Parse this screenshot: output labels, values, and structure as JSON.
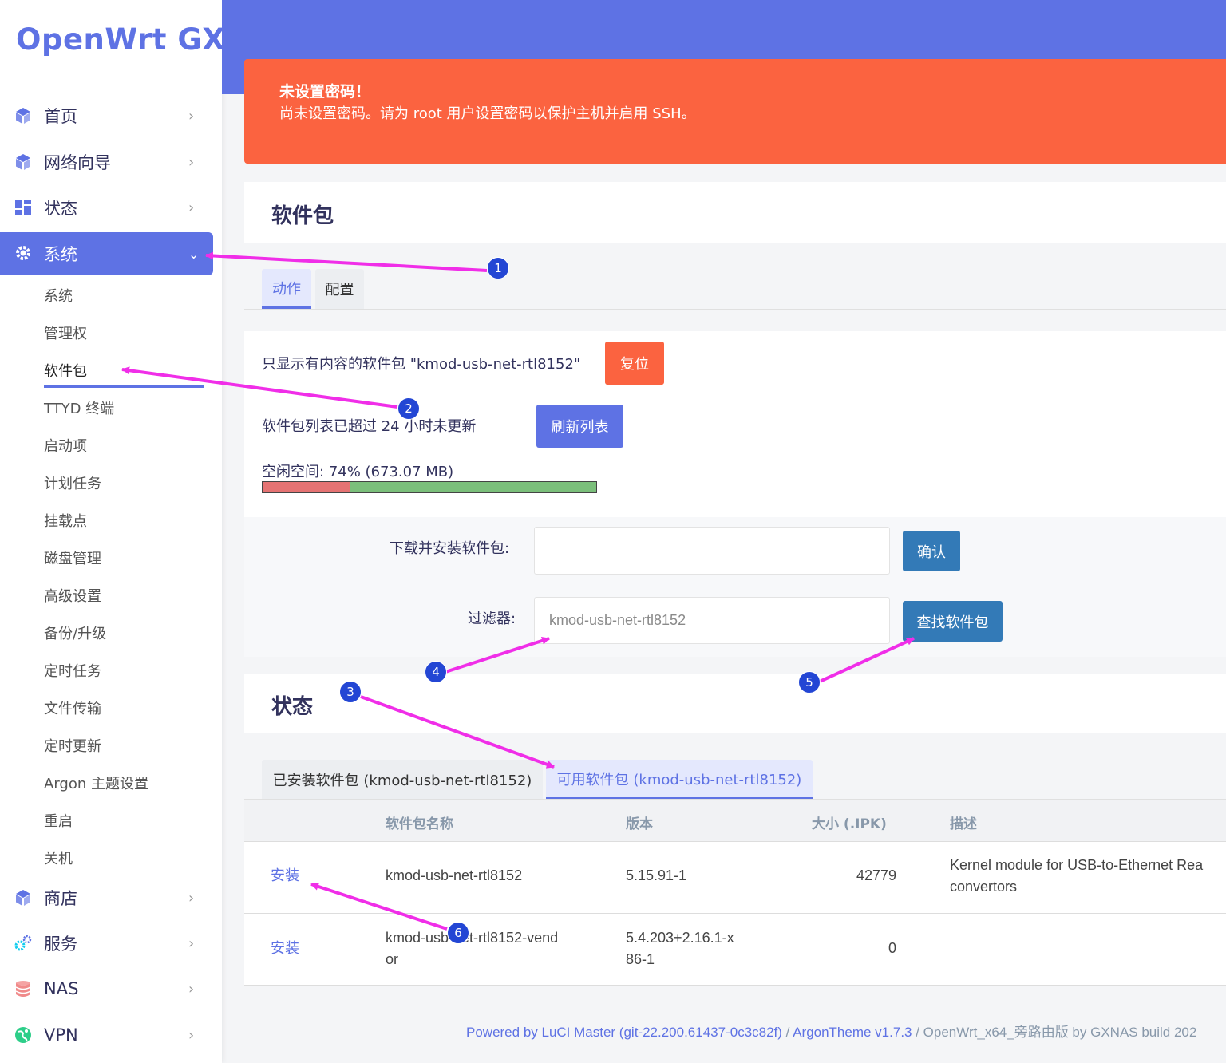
{
  "brand": "OpenWrt GXN",
  "sidebar": {
    "items": [
      {
        "label": "首页",
        "icon": "cube-icon"
      },
      {
        "label": "网络向导",
        "icon": "cube-icon"
      },
      {
        "label": "状态",
        "icon": "dashboard-icon"
      },
      {
        "label": "系统",
        "icon": "gear-icon"
      },
      {
        "label": "商店",
        "icon": "cube-icon"
      },
      {
        "label": "服务",
        "icon": "gears-icon"
      },
      {
        "label": "NAS",
        "icon": "database-icon"
      },
      {
        "label": "VPN",
        "icon": "globe-icon"
      }
    ],
    "sub_items": [
      "系统",
      "管理权",
      "软件包",
      "TTYD 终端",
      "启动项",
      "计划任务",
      "挂载点",
      "磁盘管理",
      "高级设置",
      "备份/升级",
      "定时任务",
      "文件传输",
      "定时更新",
      "Argon 主题设置",
      "重启",
      "关机"
    ]
  },
  "alert": {
    "title": "未设置密码！",
    "body": "尚未设置密码。请为 root 用户设置密码以保护主机并启用 SSH。"
  },
  "page_title": "软件包",
  "tabs": [
    "动作",
    "配置"
  ],
  "filter_notice": "只显示有内容的软件包 \"kmod-usb-net-rtl8152\"",
  "reset_label": "复位",
  "update_notice": "软件包列表已超过 24 小时未更新",
  "refresh_label": "刷新列表",
  "space": {
    "label": "空闲空间:",
    "value": "74% (673.07 MB)",
    "free_fraction": 0.74
  },
  "download": {
    "label": "下载并安装软件包:",
    "value": "",
    "button": "确认"
  },
  "filter": {
    "label": "过滤器:",
    "value": "kmod-usb-net-rtl8152",
    "button": "查找软件包"
  },
  "status_title": "状态",
  "pkg_tabs": [
    "已安装软件包 (kmod-usb-net-rtl8152)",
    "可用软件包 (kmod-usb-net-rtl8152)"
  ],
  "table": {
    "headers": [
      "软件包名称",
      "版本",
      "大小 (.IPK)",
      "描述"
    ],
    "rows": [
      {
        "action": "安装",
        "name": "kmod-usb-net-rtl8152",
        "version": "5.15.91-1",
        "size": "42779",
        "desc": "Kernel module for USB-to-Ethernet Rea convertors"
      },
      {
        "action": "安装",
        "name": "kmod-usb-net-rtl8152-vendor",
        "version": "5.4.203+2.16.1-x86-1",
        "size": "0",
        "desc": ""
      }
    ]
  },
  "footer": {
    "part1": "Powered by LuCI Master (git-22.200.61437-0c3c82f)",
    "sep1": " / ",
    "part2": "ArgonTheme v1.7.3",
    "sep2": " / ",
    "part3": "OpenWrt_x64_旁路由版 by GXNAS build 202"
  },
  "annotations": [
    "1",
    "2",
    "3",
    "4",
    "5",
    "6"
  ],
  "colors": {
    "primary": "#5e72e4",
    "alert": "#fb6340",
    "confirm": "#337ab7",
    "annotation": "#f02ee8"
  }
}
